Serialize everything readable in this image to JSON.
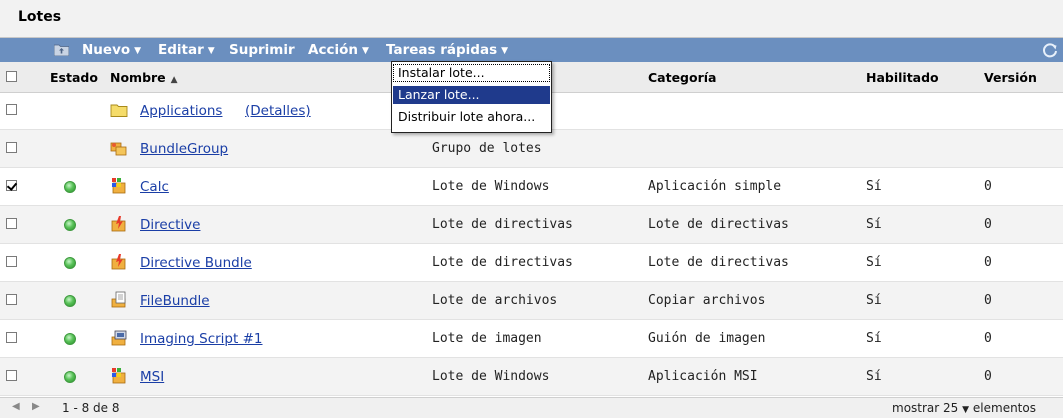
{
  "panel": {
    "title": "Lotes"
  },
  "toolbar": {
    "new_label": "Nuevo",
    "edit_label": "Editar",
    "delete_label": "Suprimir",
    "action_label": "Acción",
    "quick_tasks_label": "Tareas rápidas",
    "dropdown_arrow": "▼",
    "icons": [
      "folder-up-icon",
      "refresh-icon"
    ]
  },
  "columns": {
    "status": "Estado",
    "name": "Nombre",
    "sort_indicator": "▲",
    "category": "Categoría",
    "enabled": "Habilitado",
    "version": "Versión"
  },
  "quick_tasks_menu": {
    "items": [
      "Instalar lote...",
      "Lanzar lote...",
      "Distribuir lote ahora..."
    ],
    "selected_index": 1
  },
  "rows": [
    {
      "name": "Applications",
      "details": "(Detalles)",
      "type": "",
      "category": "",
      "enabled": "",
      "version": "",
      "icon": "folder-icon",
      "status": "",
      "checked": false
    },
    {
      "name": "BundleGroup",
      "type": "Grupo de lotes",
      "category": "",
      "enabled": "",
      "version": "",
      "icon": "bundle-group-icon",
      "status": "",
      "checked": false
    },
    {
      "name": "Calc",
      "type": "Lote de Windows",
      "category": "Aplicación simple",
      "enabled": "Sí",
      "version": "0",
      "icon": "windows-bundle-icon",
      "status": "ok",
      "checked": true
    },
    {
      "name": "Directive",
      "type": "Lote de directivas",
      "category": "Lote de directivas",
      "enabled": "Sí",
      "version": "0",
      "icon": "directive-bundle-icon",
      "status": "ok",
      "checked": false
    },
    {
      "name": "Directive Bundle",
      "type": "Lote de directivas",
      "category": "Lote de directivas",
      "enabled": "Sí",
      "version": "0",
      "icon": "directive-bundle-icon",
      "status": "ok",
      "checked": false
    },
    {
      "name": "FileBundle",
      "type": "Lote de archivos",
      "category": "Copiar archivos",
      "enabled": "Sí",
      "version": "0",
      "icon": "file-bundle-icon",
      "status": "ok",
      "checked": false
    },
    {
      "name": "Imaging Script #1",
      "type": "Lote de imagen",
      "category": "Guión de imagen",
      "enabled": "Sí",
      "version": "0",
      "icon": "imaging-bundle-icon",
      "status": "ok",
      "checked": false
    },
    {
      "name": "MSI",
      "type": "Lote de Windows",
      "category": "Aplicación MSI",
      "enabled": "Sí",
      "version": "0",
      "icon": "windows-bundle-icon",
      "status": "ok",
      "checked": false
    }
  ],
  "footer": {
    "range": "1 - 8 de 8",
    "show_label": "mostrar",
    "page_size": "25",
    "items_label": "elementos"
  },
  "colors": {
    "toolbar": "#6b8fbf",
    "link": "#1a3ea6",
    "selected": "#1f3a8c",
    "status_ok": "#59c259"
  }
}
